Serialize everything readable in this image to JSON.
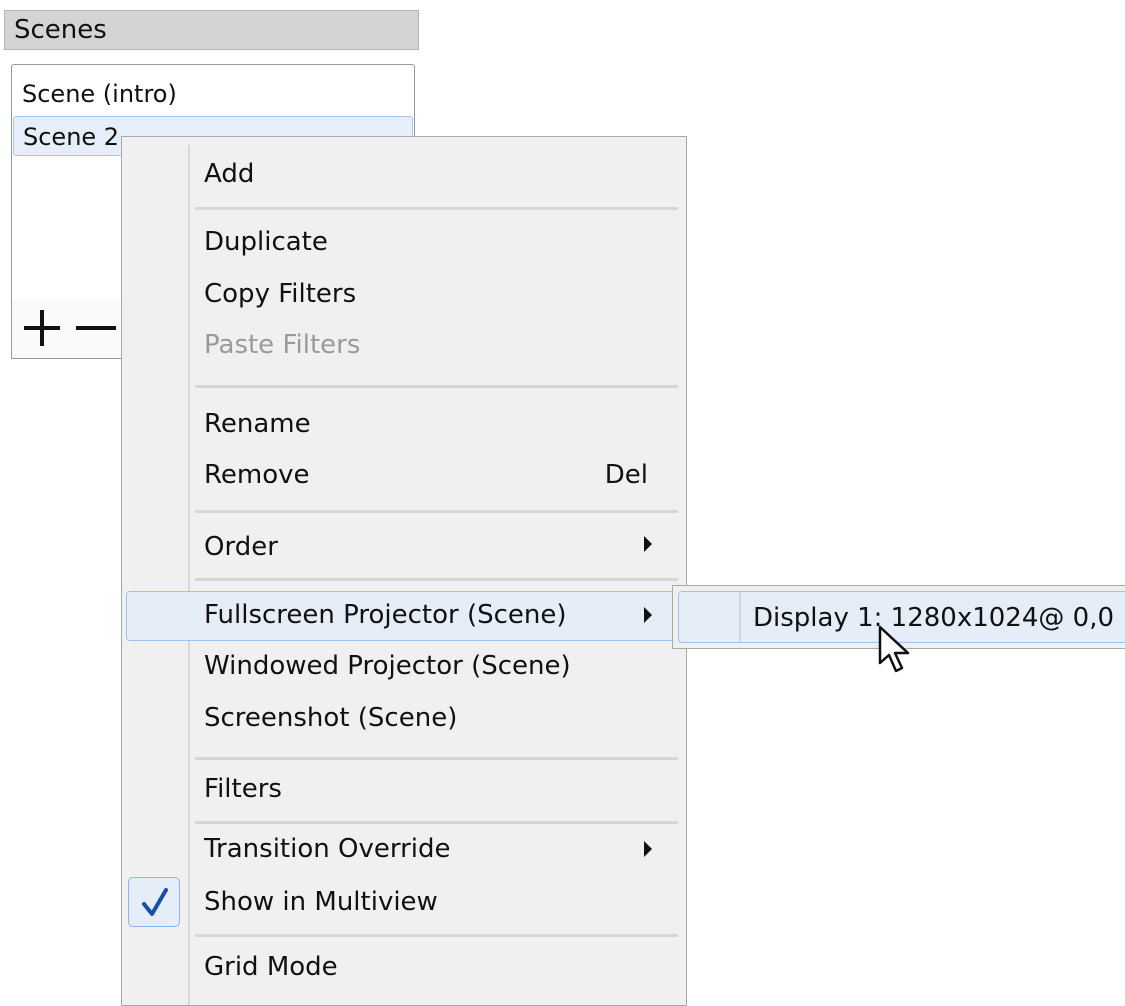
{
  "scenes_dock": {
    "title": "Scenes",
    "scenes": [
      "Scene (intro)",
      "Scene 2"
    ],
    "selected_index": 1,
    "toolbar": [
      "plus-icon",
      "minus-icon"
    ]
  },
  "context_menu": {
    "items": {
      "add": "Add",
      "duplicate": "Duplicate",
      "copy_filters": "Copy Filters",
      "paste_filters": "Paste Filters",
      "rename": "Rename",
      "remove": "Remove",
      "remove_shortcut": "Del",
      "order": "Order",
      "fullscreen_projector": "Fullscreen Projector (Scene)",
      "windowed_projector": "Windowed Projector (Scene)",
      "screenshot": "Screenshot (Scene)",
      "filters": "Filters",
      "transition_override": "Transition Override",
      "show_in_multiview": "Show in Multiview",
      "grid_mode": "Grid Mode"
    },
    "disabled": [
      "paste_filters"
    ],
    "highlighted": "fullscreen_projector",
    "checked": [
      "show_in_multiview"
    ],
    "submenu_arrows": [
      "order",
      "fullscreen_projector",
      "transition_override"
    ]
  },
  "submenu": {
    "items": [
      "Display 1: 1280x1024@ 0,0"
    ],
    "highlighted_index": 0
  },
  "colors": {
    "highlight_bg": "#e5edf8",
    "highlight_border": "#a3c0ea",
    "checkmark": "#1a4ea8",
    "menu_bg": "#f0f0f0"
  }
}
